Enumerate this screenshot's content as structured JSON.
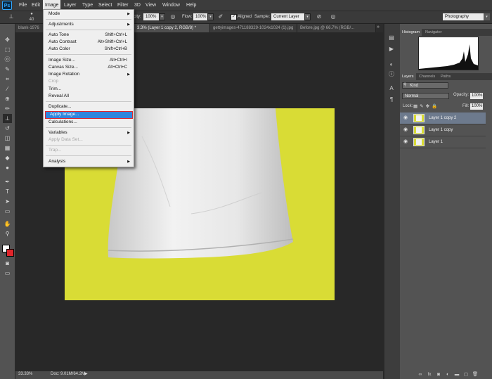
{
  "app": {
    "logo": "Ps"
  },
  "menubar": [
    "File",
    "Edit",
    "Image",
    "Layer",
    "Type",
    "Select",
    "Filter",
    "3D",
    "View",
    "Window",
    "Help"
  ],
  "options": {
    "brush_size": "40",
    "opacity_label": "city:",
    "opacity_value": "100%",
    "flow_label": "Flow:",
    "flow_value": "100%",
    "aligned_label": "Aligned",
    "sample_label": "Sample:",
    "sample_value": "Current Layer",
    "workspace": "Photography"
  },
  "tabs": [
    "blank-1976",
    "3.3% (Layer 1 copy 2, RGB/8) *",
    "gettyimages-471188329-1024x1024 (1).jpg",
    "Before.jpg @ 66.7% (RGB/..."
  ],
  "image_menu": {
    "items": [
      {
        "label": "Mode",
        "shortcut": "",
        "submenu": true,
        "disabled": false
      },
      {
        "label": "Adjustments",
        "shortcut": "",
        "submenu": true,
        "disabled": false
      },
      {
        "label": "Auto Tone",
        "shortcut": "Shift+Ctrl+L",
        "submenu": false,
        "disabled": false
      },
      {
        "label": "Auto Contrast",
        "shortcut": "Alt+Shift+Ctrl+L",
        "submenu": false,
        "disabled": false
      },
      {
        "label": "Auto Color",
        "shortcut": "Shift+Ctrl+B",
        "submenu": false,
        "disabled": false
      },
      {
        "label": "Image Size...",
        "shortcut": "Alt+Ctrl+I",
        "submenu": false,
        "disabled": false
      },
      {
        "label": "Canvas Size...",
        "shortcut": "Alt+Ctrl+C",
        "submenu": false,
        "disabled": false
      },
      {
        "label": "Image Rotation",
        "shortcut": "",
        "submenu": true,
        "disabled": false
      },
      {
        "label": "Crop",
        "shortcut": "",
        "submenu": false,
        "disabled": true
      },
      {
        "label": "Trim...",
        "shortcut": "",
        "submenu": false,
        "disabled": false
      },
      {
        "label": "Reveal All",
        "shortcut": "",
        "submenu": false,
        "disabled": false
      },
      {
        "label": "Duplicate...",
        "shortcut": "",
        "submenu": false,
        "disabled": false
      },
      {
        "label": "Apply Image...",
        "shortcut": "",
        "submenu": false,
        "disabled": false
      },
      {
        "label": "Calculations...",
        "shortcut": "",
        "submenu": false,
        "disabled": false
      },
      {
        "label": "Variables",
        "shortcut": "",
        "submenu": true,
        "disabled": false
      },
      {
        "label": "Apply Data Set...",
        "shortcut": "",
        "submenu": false,
        "disabled": true
      },
      {
        "label": "Trap...",
        "shortcut": "",
        "submenu": false,
        "disabled": true
      },
      {
        "label": "Analysis",
        "shortcut": "",
        "submenu": true,
        "disabled": false
      }
    ]
  },
  "panels": {
    "histogram_tabs": [
      "Histogram",
      "Navigator"
    ],
    "layers_tabs": [
      "Layers",
      "Channels",
      "Paths"
    ],
    "kind": "Kind",
    "blend_mode": "Normal",
    "opacity_label": "Opacity:",
    "opacity_value": "100%",
    "lock_label": "Lock:",
    "fill_label": "Fill:",
    "fill_value": "100%",
    "layers": [
      {
        "name": "Layer 1 copy 2",
        "selected": true
      },
      {
        "name": "Layer 1 copy",
        "selected": false
      },
      {
        "name": "Layer 1",
        "selected": false
      }
    ]
  },
  "status": {
    "zoom": "33.33%",
    "doc": "Doc: 9.01M/64.2M"
  },
  "colors": {
    "canvas_bg": "#d9dc35",
    "highlight": "#2f86dd",
    "outline": "#e0252b"
  }
}
